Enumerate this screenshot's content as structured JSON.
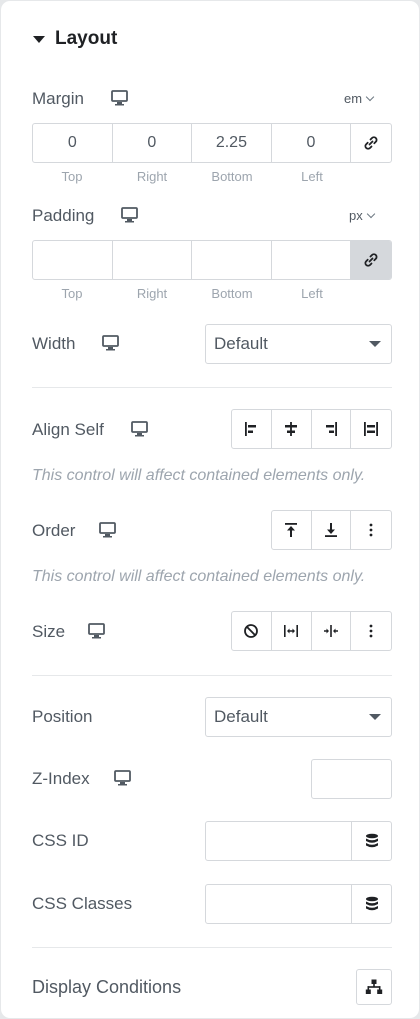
{
  "section": {
    "title": "Layout"
  },
  "margin": {
    "label": "Margin",
    "unit": "em",
    "values": {
      "top": "0",
      "right": "0",
      "bottom": "2.25",
      "left": "0"
    },
    "sublabels": {
      "top": "Top",
      "right": "Right",
      "bottom": "Bottom",
      "left": "Left"
    }
  },
  "padding": {
    "label": "Padding",
    "unit": "px",
    "values": {
      "top": "",
      "right": "",
      "bottom": "",
      "left": ""
    },
    "sublabels": {
      "top": "Top",
      "right": "Right",
      "bottom": "Bottom",
      "left": "Left"
    }
  },
  "width": {
    "label": "Width",
    "value": "Default"
  },
  "align_self": {
    "label": "Align Self",
    "note": "This control will affect contained elements only."
  },
  "order": {
    "label": "Order",
    "note": "This control will affect contained elements only."
  },
  "size": {
    "label": "Size"
  },
  "position": {
    "label": "Position",
    "value": "Default"
  },
  "z_index": {
    "label": "Z-Index",
    "value": ""
  },
  "css_id": {
    "label": "CSS ID",
    "value": ""
  },
  "css_classes": {
    "label": "CSS Classes",
    "value": ""
  },
  "display_conditions": {
    "label": "Display Conditions"
  },
  "icons": {
    "responsive": "desktop-monitor-icon",
    "link": "link-chain-icon",
    "dynamic": "database-icon",
    "conditions": "sitemap-icon"
  },
  "colors": {
    "label": "#515962",
    "muted": "#9da5ae",
    "border": "#d5d8dc",
    "active_bg": "#d5d8dc",
    "title": "#1f2124"
  }
}
